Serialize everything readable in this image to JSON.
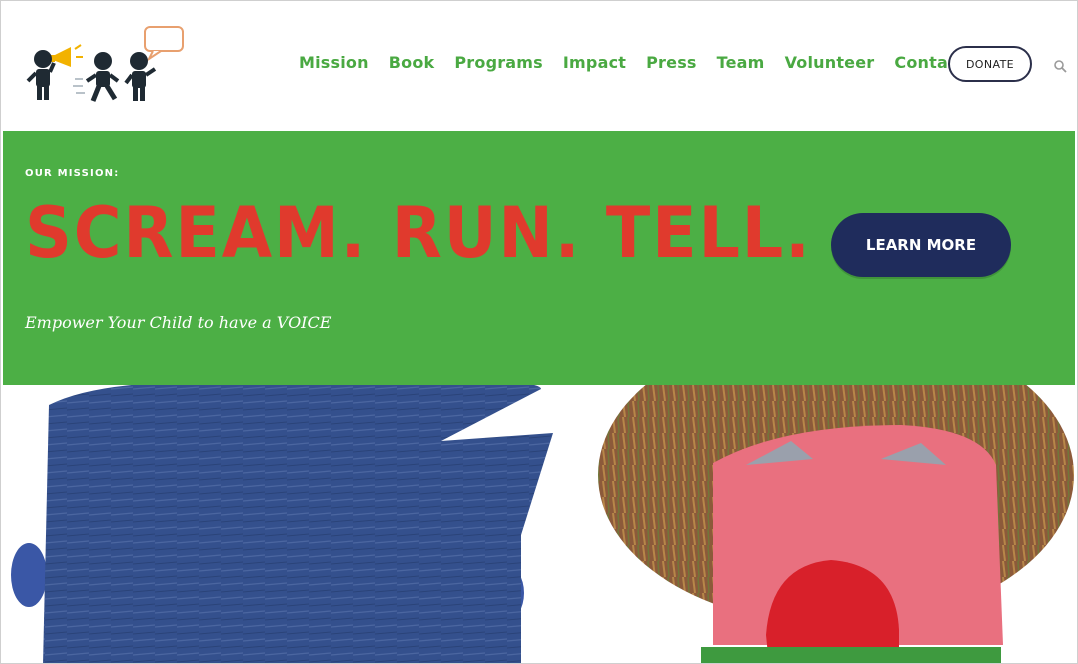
{
  "header": {
    "logo": {
      "icon": "kids-megaphone-speech-logo"
    },
    "nav": {
      "items": [
        "Mission",
        "Book",
        "Programs",
        "Impact",
        "Press",
        "Team",
        "Volunteer",
        "Contact"
      ]
    },
    "donate_label": "DONATE",
    "search_icon": "search-icon"
  },
  "hero": {
    "eyebrow": "OUR MISSION:",
    "headline": "SCREAM. RUN. TELL.",
    "tagline": "Empower Your Child to have a VOICE",
    "cta_label": "LEARN MORE",
    "colors": {
      "banner": "#4caf45",
      "headline": "#e03a2d",
      "cta_background": "#1f2c5c",
      "nav_text": "#4aa942"
    }
  },
  "art": {
    "left_figure": "blue-collage-head",
    "right_figure": "pink-face-screaming"
  }
}
